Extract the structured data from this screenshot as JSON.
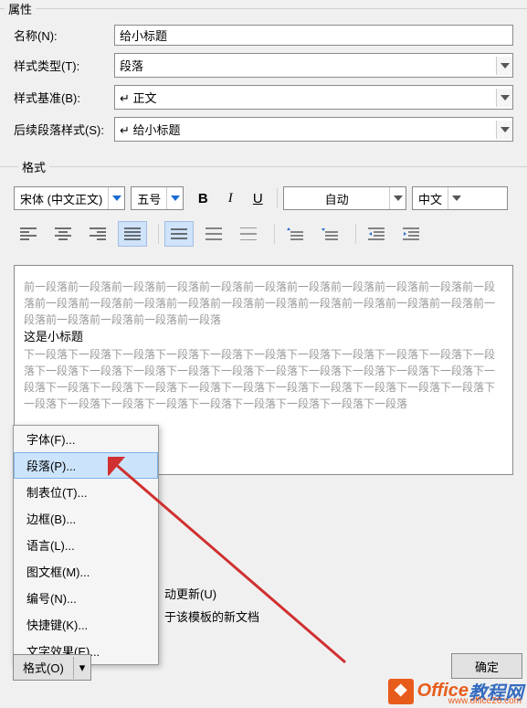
{
  "sections": {
    "properties": "属性",
    "format": "格式"
  },
  "props": {
    "name_label": "名称(N):",
    "name_value": "给小标题",
    "type_label": "样式类型(T):",
    "type_value": "段落",
    "base_label": "样式基准(B):",
    "base_value": "↵ 正文",
    "next_label": "后续段落样式(S):",
    "next_value": "↵ 给小标题"
  },
  "toolbar": {
    "font": "宋体 (中文正文)",
    "size": "五号",
    "bold": "B",
    "italic": "I",
    "underline": "U",
    "autocolor": "自动",
    "lang": "中文"
  },
  "preview": {
    "prev": "前一段落前一段落前一段落前一段落前一段落前一段落前一段落前一段落前一段落前一段落前一段落前一段落前一段落前一段落前一段落前一段落前一段落前一段落前一段落前一段落前一段落前一段落前一段落前一段落前一段落前一段落",
    "current": "这是小标题",
    "next": "下一段落下一段落下一段落下一段落下一段落下一段落下一段落下一段落下一段落下一段落下一段落下一段落下一段落下一段落下一段落下一段落下一段落下一段落下一段落下一段落下一段落下一段落下一段落下一段落下一段落下一段落下一段落下一段落下一段落下一段落下一段落下一段落下一段落下一段落下一段落下一段落下一段落下一段落下一段落下一段落下一段落"
  },
  "menu": {
    "font": "字体(F)...",
    "paragraph": "段落(P)...",
    "tabs": "制表位(T)...",
    "border": "边框(B)...",
    "language": "语言(L)...",
    "frame": "图文框(M)...",
    "numbering": "编号(N)...",
    "shortcut": "快捷键(K)...",
    "texteffect": "文字效果(E)..."
  },
  "options": {
    "autoupdate": "动更新(U)",
    "templatedocs": "于该模板的新文档"
  },
  "buttons": {
    "format": "格式(O)",
    "ok": "确定"
  },
  "watermark": {
    "t1": "Office",
    "t2": "教程网",
    "url": "www.office26.com"
  }
}
